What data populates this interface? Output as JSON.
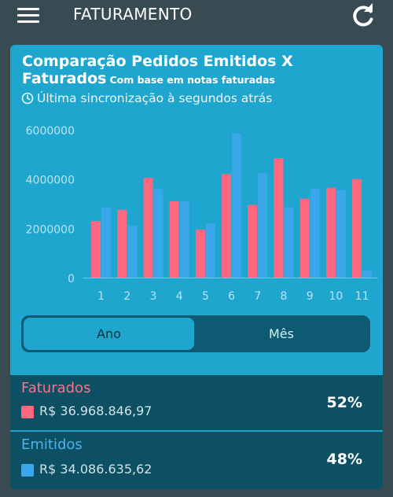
{
  "header": {
    "title": "FATURAMENTO",
    "menu_icon": "hamburger-menu-icon",
    "refresh_icon": "refresh-icon"
  },
  "card": {
    "title": "Comparação Pedidos Emitidos X Faturados",
    "subtitle": "Com base em notas faturadas",
    "sync_text": "Última sincronização à segundos atrás",
    "sync_icon": "clock-icon",
    "background": "#1ea6cf"
  },
  "chart_data": {
    "type": "bar",
    "categories": [
      "1",
      "2",
      "3",
      "4",
      "5",
      "6",
      "7",
      "8",
      "9",
      "10",
      "11"
    ],
    "series": [
      {
        "name": "Faturados",
        "color": "#ff6680",
        "values": [
          2300000,
          2750000,
          4050000,
          3100000,
          1950000,
          4200000,
          2950000,
          4850000,
          3200000,
          3650000,
          4000000
        ]
      },
      {
        "name": "Emitidos",
        "color": "#3aa7ea",
        "values": [
          2850000,
          2100000,
          3600000,
          3100000,
          2200000,
          5850000,
          4250000,
          2850000,
          3600000,
          3550000,
          300000
        ]
      }
    ],
    "yticks": [
      "0",
      "2000000",
      "4000000",
      "6000000"
    ],
    "ylim": [
      0,
      6000000
    ],
    "grid": false
  },
  "toggle": {
    "options": [
      "Ano",
      "Mês"
    ],
    "selected": "Ano"
  },
  "summary": {
    "faturados": {
      "label": "Faturados",
      "value": "R$ 36.968.846,97",
      "percent": "52%",
      "color": "#ff6680"
    },
    "emitidos": {
      "label": "Emitidos",
      "value": "R$ 34.086.635,62",
      "percent": "48%",
      "color": "#3aa7ea"
    }
  }
}
